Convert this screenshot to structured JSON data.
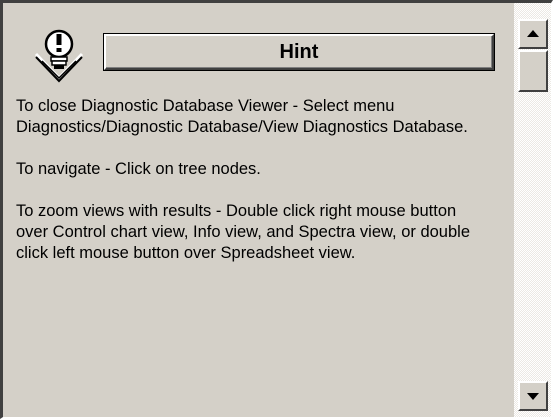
{
  "hint": {
    "title": "Hint",
    "icon": "hint-lightbulb-icon",
    "paragraphs": [
      "To close Diagnostic Database Viewer - Select menu Diagnostics/Diagnostic Database/View Diagnostics Database.",
      "To navigate - Click on tree nodes.",
      "To zoom views with results - Double click right mouse button over Control chart view, Info view, and Spectra view, or double click left mouse button over Spreadsheet view."
    ]
  },
  "scrollbar": {
    "up_icon": "scroll-up-arrow-icon",
    "down_icon": "scroll-down-arrow-icon"
  },
  "colors": {
    "face": "#d4d0c8",
    "text": "#000000"
  }
}
